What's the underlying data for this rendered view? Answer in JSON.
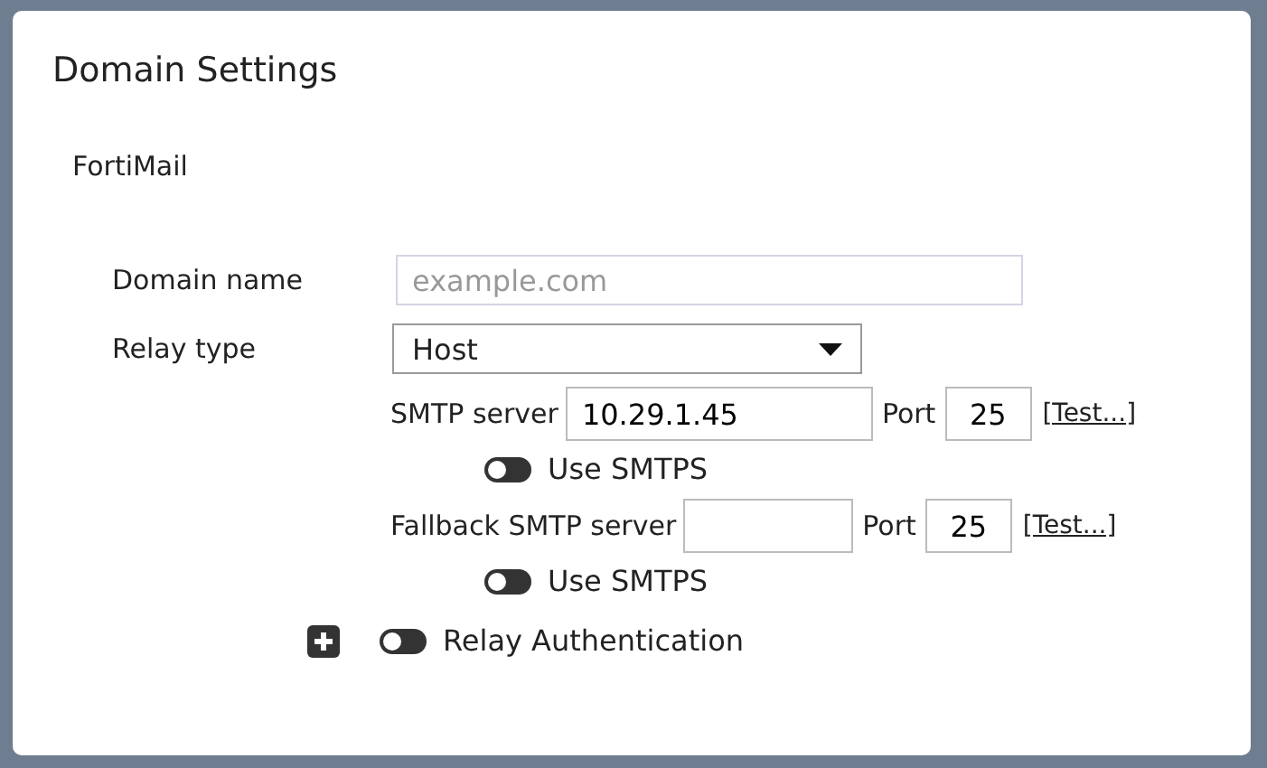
{
  "title": "Domain Settings",
  "section": "FortiMail",
  "domain_name": {
    "label": "Domain name",
    "placeholder": "example.com"
  },
  "relay_type": {
    "label": "Relay type",
    "value": "Host"
  },
  "servers": [
    {
      "label": "SMTP server",
      "value": "10.29.1.45",
      "port_label": "Port",
      "port": "25",
      "test": "[Test...]",
      "smtps": {
        "label": "Use SMTPS",
        "on": false
      }
    },
    {
      "label": "Fallback SMTP server",
      "port_label": "Port",
      "port": "25",
      "test": "[Test...]",
      "smtps": {
        "label": "Use SMTPS",
        "on": false
      }
    }
  ],
  "relay_auth": {
    "label": "Relay Authentication",
    "on": false,
    "expanded": false
  }
}
